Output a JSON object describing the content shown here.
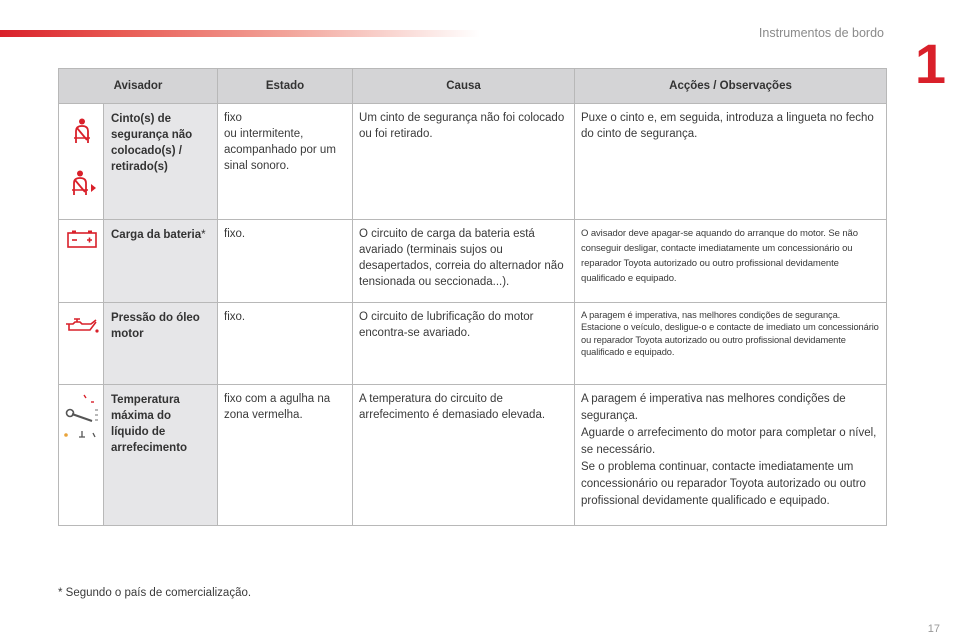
{
  "header": {
    "section_title": "Instrumentos de bordo",
    "chapter_number": "1"
  },
  "table": {
    "columns": [
      "Avisador",
      "Estado",
      "Causa",
      "Acções / Observações"
    ],
    "rows": [
      {
        "icons": [
          "seatbelt-warning-icon",
          "seatbelt-warning-arrow-icon"
        ],
        "name": "Cinto(s) de segurança não colocado(s) / retirado(s)",
        "estado": "fixo\nou intermitente,\nacompanhado por um sinal sonoro.",
        "causa": "Um cinto de segurança não foi colocado ou foi retirado.",
        "accoes": "Puxe o cinto e, em seguida, introduza a lingueta no fecho do cinto de segurança."
      },
      {
        "icons": [
          "battery-charge-icon"
        ],
        "name": "Carga da bateria",
        "name_marker": "*",
        "estado": "fixo.",
        "causa": "O circuito de carga da bateria está avariado (terminais sujos ou desapertados, correia do alternador não tensionada ou seccionada...).",
        "accoes": "O avisador deve apagar-se aquando do arranque do motor. Se não conseguir desligar, contacte imediatamente um concessionário ou reparador Toyota autorizado ou outro profissional devidamente qualificado e equipado."
      },
      {
        "icons": [
          "oil-pressure-icon"
        ],
        "name": "Pressão do óleo motor",
        "estado": "fixo.",
        "causa": "O circuito de lubrificação do motor encontra-se avariado.",
        "accoes": "A paragem é imperativa, nas melhores condições de segurança.\nEstacione o veículo, desligue-o e contacte de imediato um concessionário ou reparador Toyota autorizado ou outro profissional devidamente qualificado e equipado."
      },
      {
        "icons": [
          "coolant-temperature-icon"
        ],
        "name": "Temperatura máxima do líquido de arrefecimento",
        "estado": "fixo com a agulha na zona vermelha.",
        "causa": "A temperatura do circuito de arrefecimento é demasiado elevada.",
        "accoes": "A paragem é imperativa nas melhores condições de segurança.\nAguarde o arrefecimento do motor para completar o nível, se necessário.\nSe o problema continuar, contacte imediatamente um concessionário ou reparador Toyota autorizado ou outro profissional devidamente qualificado e equipado."
      }
    ]
  },
  "footnote": "* Segundo o país de comercialização.",
  "page_number": "17",
  "colors": {
    "brand_red": "#d9202a",
    "header_bg": "#d4d4d6",
    "name_bg": "#e6e6e8",
    "border": "#b8b8b8"
  }
}
